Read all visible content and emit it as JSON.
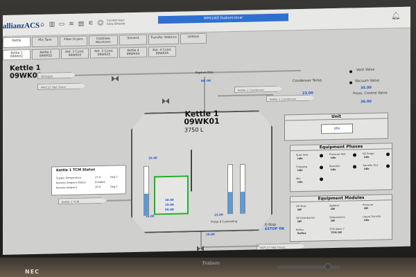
{
  "window": {
    "title": "MPS1WZ.foxboro.local"
  },
  "header": {
    "logo": "allianzACS",
    "current_user": "Current User\nCorp Director"
  },
  "tabs_row1": [
    "Kettle",
    "Mix Tank",
    "Filter Dryers",
    "Distillate Receivers",
    "Solvent",
    "Transfer Stations",
    "Utilities"
  ],
  "tabs_row2": [
    "Kettle 1\n09WK01",
    "Kettle 2\n09WK02",
    "Ket. 3 Cond.\n09WK03",
    "Ket. 3 Cond.\n09WK03",
    "Kettle 4\n09WK04",
    "Ket. 4 Cond.\n09WK05"
  ],
  "page": {
    "title_line1": "Kettle 1",
    "title_line2": "09WK01"
  },
  "pipes": {
    "nitrogen": "Nitrogen",
    "tcm_feed_top": "PAP11T Wat Panel",
    "rupture": "Rupture Disk",
    "rupture_val": "KO OK",
    "kettle_condenser1": "Kettle 1 Condenser",
    "kettle_condenser2": "Kettle 1 Condenser",
    "condenser_temp": "Condenser Temp.",
    "condenser_val": "23.00",
    "vent_valve": "Vent Valve",
    "vacuum_valve": "Vacuum Valve",
    "vacuum_val": "35.00",
    "press_control": "Press. Control Valve",
    "press_val": "36.00",
    "kettle_tcm": "Kettle 1 TCM",
    "bottom_feed": "PAP11T Wat Panel"
  },
  "vessel": {
    "name": "Kettle 1",
    "tag": "09WK01",
    "volume": "3750 L",
    "temp_top": "16.00",
    "temp_left": "16.00",
    "green": {
      "line1": "16.00",
      "line2": "19.00",
      "line3": "05.00"
    },
    "level_pct": "23.00",
    "level_fill": 0.45,
    "probe": "Probe 8 Controlling",
    "bottom_val": "16.00"
  },
  "unit_panel": {
    "heading": "Unit",
    "value": "Idle"
  },
  "phases": {
    "heading": "Equipment Phases",
    "items": [
      {
        "label": "Start Shd",
        "val": "Idle"
      },
      {
        "label": "Pressure Test",
        "val": "Idle"
      },
      {
        "label": "N2 Purge",
        "val": "Idle"
      },
      {
        "label": "Charging",
        "val": "Idle"
      },
      {
        "label": "Reaction",
        "val": "Idle"
      },
      {
        "label": "Transfer Out",
        "val": "Idle"
      },
      {
        "label": "Idle",
        "val": "Idle"
      }
    ]
  },
  "modules": {
    "heading": "Equipment Modules",
    "items": [
      {
        "label": "OP Shot",
        "val": "Off"
      },
      {
        "label": "Agitator",
        "val": "Off"
      },
      {
        "label": "Pressure",
        "val": "Off"
      },
      {
        "label": "OP Distribution",
        "val": "Off"
      },
      {
        "label": "Temperature",
        "val": "Off"
      },
      {
        "label": "Liquid Transfer",
        "val": "Idle"
      },
      {
        "label": "Reflux",
        "val": "Reflux"
      },
      {
        "label": "TCM Valve Y",
        "val": "TCM Off"
      }
    ]
  },
  "tcm_status": {
    "heading": "Kettle 1 TCM Status",
    "rows": [
      {
        "label": "Supply Temperature",
        "val": "23.0",
        "unit": "Deg C"
      },
      {
        "label": "Remote Setpoint Status",
        "val": "Enabled",
        "unit": ""
      },
      {
        "label": "Remote Setpoint",
        "val": "20.0",
        "unit": "Deg C"
      }
    ]
  },
  "estop": {
    "label": "E-Stop",
    "value": "ESTOP OK"
  },
  "monitor": {
    "brand": "NEC",
    "center": "Foxboro"
  }
}
